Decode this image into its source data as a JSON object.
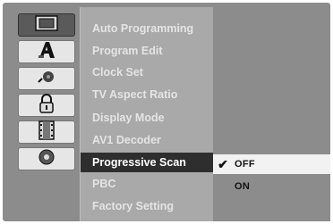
{
  "menu": {
    "items": [
      {
        "label": "Auto Programming"
      },
      {
        "label": "Program Edit"
      },
      {
        "label": "Clock Set"
      },
      {
        "label": "TV Aspect Ratio"
      },
      {
        "label": "Display Mode"
      },
      {
        "label": "AV1 Decoder"
      },
      {
        "label": "Progressive Scan",
        "selected": true
      },
      {
        "label": "PBC"
      },
      {
        "label": "Factory Setting"
      }
    ]
  },
  "icons": [
    {
      "name": "general-settings-icon",
      "active": true
    },
    {
      "name": "language-icon"
    },
    {
      "name": "audio-icon"
    },
    {
      "name": "lock-icon"
    },
    {
      "name": "recording-icon"
    },
    {
      "name": "disc-icon"
    }
  ],
  "options": {
    "items": [
      {
        "label": "OFF",
        "checked": true,
        "check_mark": "✔"
      },
      {
        "label": "ON",
        "checked": false,
        "check_mark": ""
      }
    ]
  },
  "colors": {
    "background": "#8c8c8c",
    "menu_panel": "#a9a9a9",
    "highlight": "#2e2e2e",
    "option_highlight": "#f2f2f2"
  }
}
